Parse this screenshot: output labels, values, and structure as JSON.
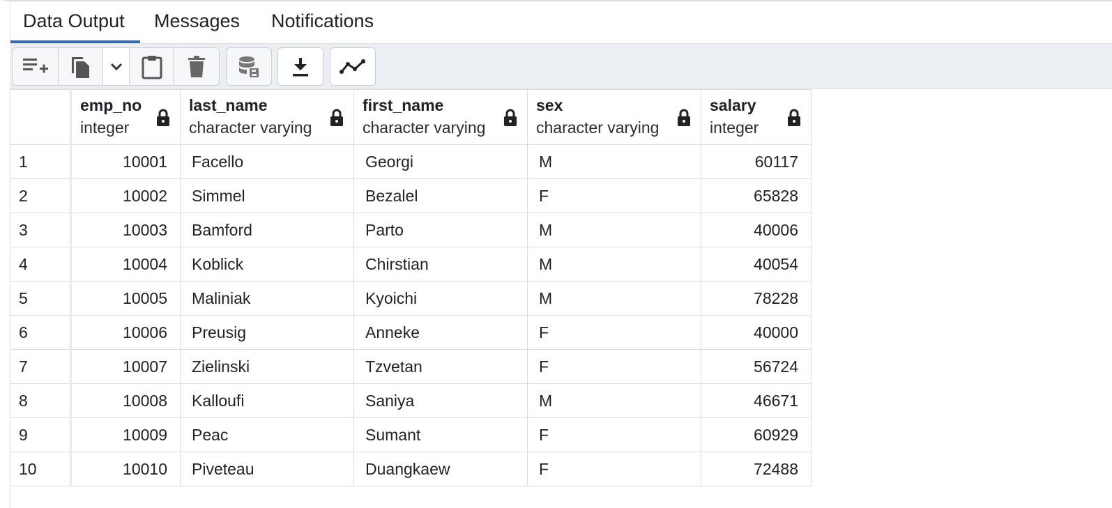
{
  "tabs": [
    {
      "label": "Data Output",
      "active": true
    },
    {
      "label": "Messages",
      "active": false
    },
    {
      "label": "Notifications",
      "active": false
    }
  ],
  "toolbar": {
    "buttons": [
      {
        "name": "add-row-button",
        "icon": "add-row-icon"
      },
      {
        "name": "copy-button",
        "icon": "copy-icon"
      },
      {
        "name": "copy-options-button",
        "icon": "chevron-down-icon"
      },
      {
        "name": "paste-button",
        "icon": "clipboard-icon"
      },
      {
        "name": "delete-button",
        "icon": "trash-icon"
      },
      {
        "name": "save-data-button",
        "icon": "database-save-icon"
      },
      {
        "name": "download-button",
        "icon": "download-icon"
      },
      {
        "name": "graph-button",
        "icon": "line-graph-icon"
      }
    ]
  },
  "grid": {
    "columns": [
      {
        "name": "emp_no",
        "type": "integer",
        "align": "right"
      },
      {
        "name": "last_name",
        "type": "character varying",
        "align": "left"
      },
      {
        "name": "first_name",
        "type": "character varying",
        "align": "left"
      },
      {
        "name": "sex",
        "type": "character varying",
        "align": "left"
      },
      {
        "name": "salary",
        "type": "integer",
        "align": "right"
      }
    ],
    "rows": [
      {
        "n": "1",
        "cells": [
          "10001",
          "Facello",
          "Georgi",
          "M",
          "60117"
        ]
      },
      {
        "n": "2",
        "cells": [
          "10002",
          "Simmel",
          "Bezalel",
          "F",
          "65828"
        ]
      },
      {
        "n": "3",
        "cells": [
          "10003",
          "Bamford",
          "Parto",
          "M",
          "40006"
        ]
      },
      {
        "n": "4",
        "cells": [
          "10004",
          "Koblick",
          "Chirstian",
          "M",
          "40054"
        ]
      },
      {
        "n": "5",
        "cells": [
          "10005",
          "Maliniak",
          "Kyoichi",
          "M",
          "78228"
        ]
      },
      {
        "n": "6",
        "cells": [
          "10006",
          "Preusig",
          "Anneke",
          "F",
          "40000"
        ]
      },
      {
        "n": "7",
        "cells": [
          "10007",
          "Zielinski",
          "Tzvetan",
          "F",
          "56724"
        ]
      },
      {
        "n": "8",
        "cells": [
          "10008",
          "Kalloufi",
          "Saniya",
          "M",
          "46671"
        ]
      },
      {
        "n": "9",
        "cells": [
          "10009",
          "Peac",
          "Sumant",
          "F",
          "60929"
        ]
      },
      {
        "n": "10",
        "cells": [
          "10010",
          "Piveteau",
          "Duangkaew",
          "F",
          "72488"
        ]
      }
    ]
  },
  "colors": {
    "accent": "#346aa8",
    "toolbar_bg": "#ebeef2",
    "grid_border": "#dadde2"
  }
}
